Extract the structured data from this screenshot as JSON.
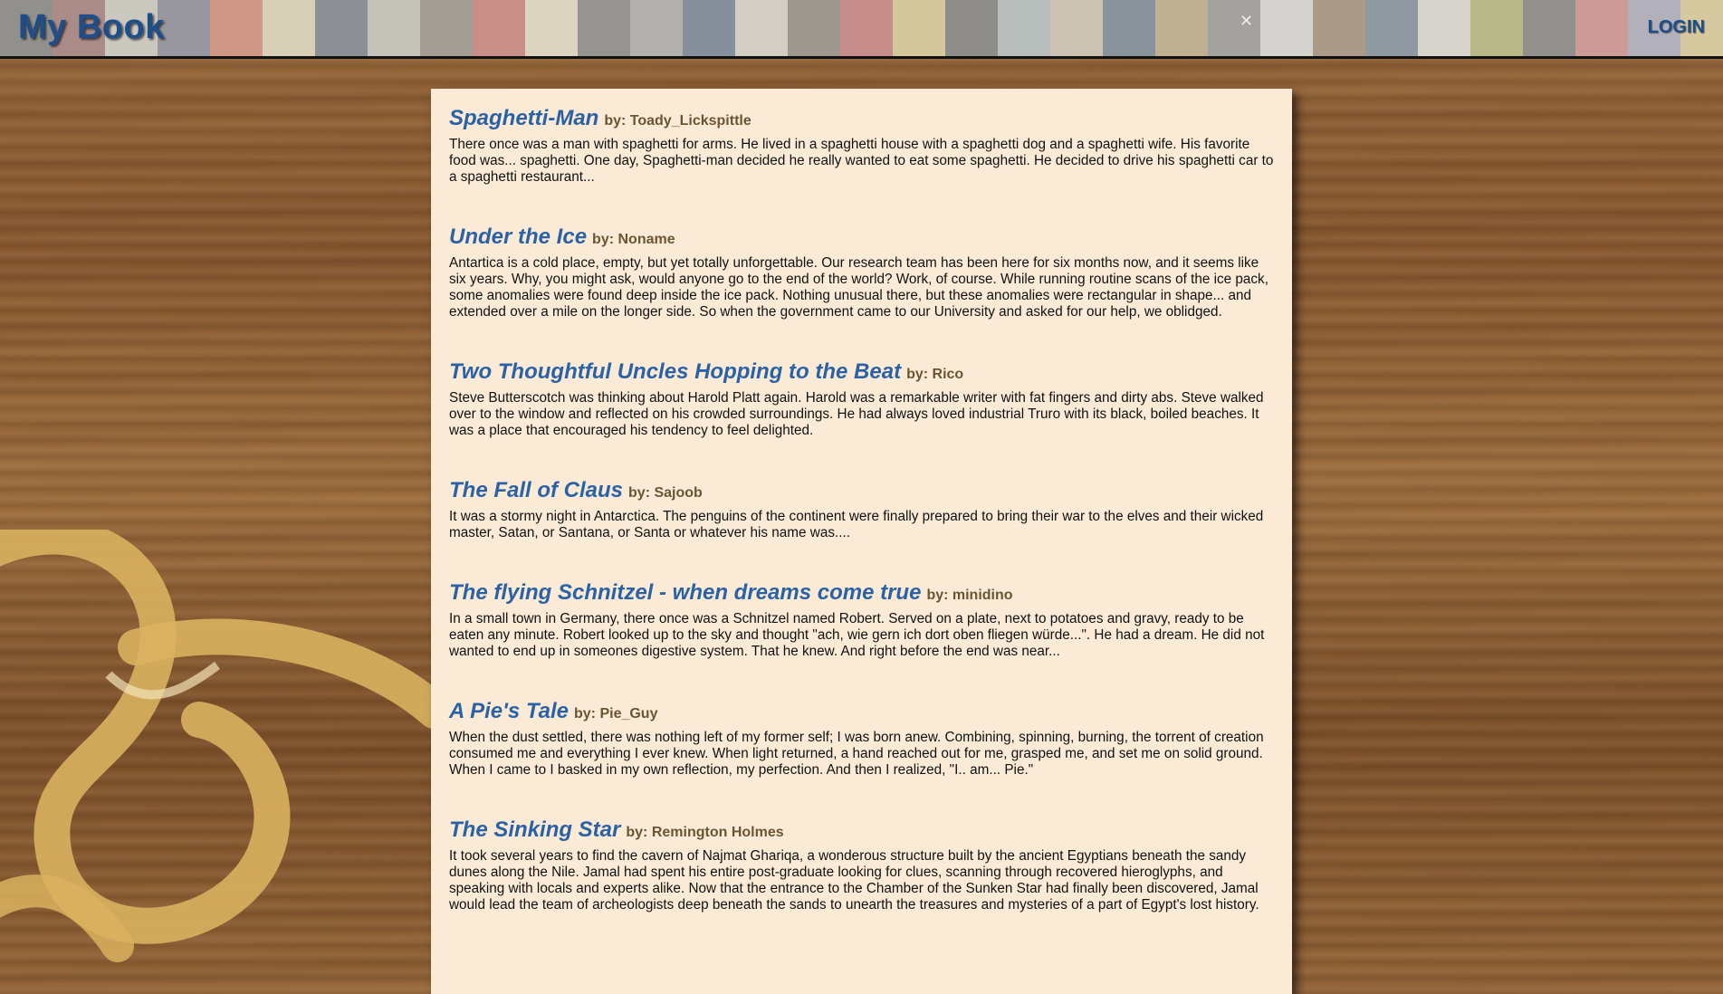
{
  "header": {
    "logo": "My Book",
    "login_label": "LOGIN",
    "cover_colors": [
      "#3a3a3a",
      "#7a2e2e",
      "#c9c3b6",
      "#4a4a6a",
      "#d44a2a",
      "#e8d3a0",
      "#2f3b4a",
      "#b8b2a8",
      "#6a5a4a",
      "#c0392b",
      "#f0e0b0",
      "#444",
      "#8a8a8a",
      "#1e3a5f",
      "#d8d0c0",
      "#5a4a3a",
      "#b33",
      "#e0c060",
      "#333",
      "#9aa",
      "#c7b299",
      "#27415e",
      "#a84",
      "#666",
      "#ddd",
      "#7a5230",
      "#35506b",
      "#e5e0d5",
      "#993",
      "#3b3b3b",
      "#c55",
      "#88a",
      "#e2c56a",
      "#4a3b2b",
      "#bbb",
      "#2c2c2c"
    ]
  },
  "stories": [
    {
      "title": "Spaghetti-Man",
      "author": "by: Toady_Lickspittle",
      "excerpt": "There once was a man with spaghetti for arms. He lived in a spaghetti house with a spaghetti dog and a spaghetti wife. His favorite food was... spaghetti. One day, Spaghetti-man decided he really wanted to eat some spaghetti. He decided to drive his spaghetti car to a spaghetti restaurant..."
    },
    {
      "title": "Under the Ice",
      "author": "by: Noname",
      "excerpt": "Antartica is a cold place, empty, but yet totally unforgettable. Our research team has been here for six months now, and it seems like six years. Why, you might ask, would anyone go to the end of the world? Work, of course. While running routine scans of the ice pack, some anomalies were found deep inside the ice pack. Nothing unusual there, but these anomalies were rectangular in shape... and extended over a mile on the longer side. So when the government came to our University and asked for our help, we oblidged."
    },
    {
      "title": "Two Thoughtful Uncles Hopping to the Beat",
      "author": "by: Rico",
      "excerpt": "Steve Butterscotch was thinking about Harold Platt again. Harold was a remarkable writer with fat fingers and dirty abs. Steve walked over to the window and reflected on his crowded surroundings. He had always loved industrial Truro with its black, boiled beaches. It was a place that encouraged his tendency to feel delighted."
    },
    {
      "title": "The Fall of Claus",
      "author": "by: Sajoob",
      "excerpt": "It was a stormy night in Antarctica. The penguins of the continent were finally prepared to bring their war to the elves and their wicked master, Satan, or Santana, or Santa or whatever his name was...."
    },
    {
      "title": "The flying Schnitzel - when dreams come true",
      "author": "by: minidino",
      "excerpt": "In a small town in Germany, there once was a Schnitzel named Robert. Served on a plate, next to potatoes and gravy, ready to be eaten any minute. Robert looked up to the sky and thought \"ach, wie gern ich dort oben fliegen würde...\". He had a dream. He did not wanted to end up in someones digestive system. That he knew. And right before the end was near..."
    },
    {
      "title": "A Pie's Tale",
      "author": "by: Pie_Guy",
      "excerpt": "When the dust settled, there was nothing left of my former self; I was born anew. Combining, spinning, burning, the torrent of creation consumed me and everything I ever knew. When light returned, a hand reached out for me, grasped me, and set me on solid ground. When I came to I basked in my own reflection, my perfection. And then I realized, \"I.. am... Pie.\""
    },
    {
      "title": "The Sinking Star",
      "author": "by: Remington Holmes",
      "excerpt": "It took several years to find the cavern of Najmat Ghariqa, a wonderous structure built by the ancient Egyptians beneath the sandy dunes along the Nile. Jamal had spent his entire post-graduate looking for clues, scanning through recovered hieroglyphs, and speaking with locals and experts alike. Now that the entrance to the Chamber of the Sunken Star had finally been discovered, Jamal would lead the team of archeologists deep beneath the sands to unearth the treasures and mysteries of a part of Egypt's lost history."
    }
  ]
}
